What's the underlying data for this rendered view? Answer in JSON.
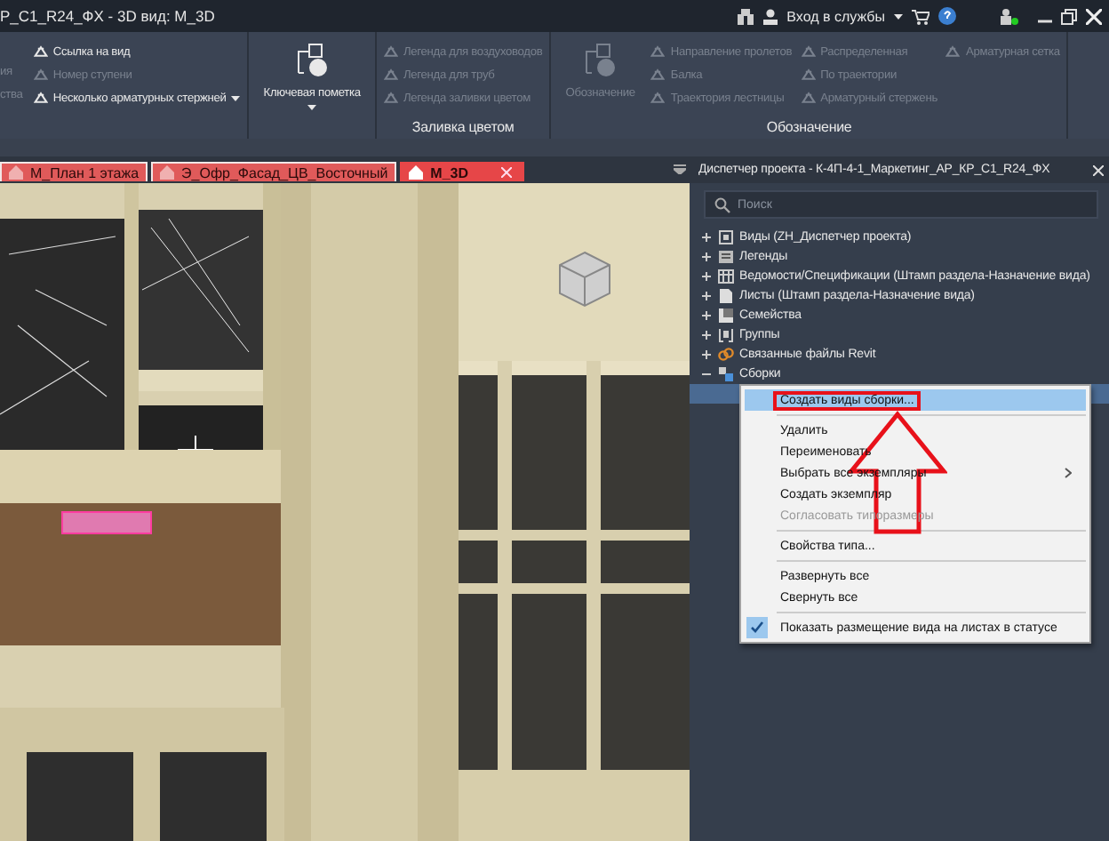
{
  "window": {
    "title": "Р_С1_R24_ФХ - 3D вид: М_3D",
    "sign_in": "Вход в службы"
  },
  "ribbon": {
    "cut_column": [
      "ия",
      "ства"
    ],
    "groups": [
      {
        "columns": [
          {
            "kind": "list",
            "items": [
              {
                "label": "Ссылка на вид",
                "disabled": false
              },
              {
                "label": "Номер ступени",
                "disabled": true
              },
              {
                "label": "Несколько арматурных стержней",
                "disabled": false,
                "dropdown": true
              }
            ]
          }
        ]
      },
      {
        "columns": [
          {
            "kind": "big",
            "label": "Ключевая пометка",
            "disabled": false,
            "dropdown": true
          }
        ]
      },
      {
        "title": "Заливка цветом",
        "columns": [
          {
            "kind": "list",
            "items": [
              {
                "label": "Легенда для воздуховодов",
                "disabled": true
              },
              {
                "label": "Легенда для труб",
                "disabled": true
              },
              {
                "label": "Легенда заливки цветом",
                "disabled": true
              }
            ]
          }
        ]
      },
      {
        "title": "Обозначение",
        "columns": [
          {
            "kind": "big",
            "label": "Обозначение",
            "disabled": true
          },
          {
            "kind": "list",
            "items": [
              {
                "label": "Направление пролетов",
                "disabled": true
              },
              {
                "label": "Балка",
                "disabled": true
              },
              {
                "label": "Траектория  лестницы",
                "disabled": true
              }
            ]
          },
          {
            "kind": "list",
            "items": [
              {
                "label": "Распределенная",
                "disabled": true
              },
              {
                "label": "По траектории",
                "disabled": true
              },
              {
                "label": "Арматурный стержень",
                "disabled": true
              }
            ]
          },
          {
            "kind": "list",
            "items": [
              {
                "label": "Арматурная сетка",
                "disabled": true
              }
            ]
          }
        ]
      }
    ]
  },
  "tabs": [
    {
      "label": "М_План 1 этажа",
      "selected": false
    },
    {
      "label": "Э_Офр_Фасад_ЦВ_Восточный",
      "selected": false
    },
    {
      "label": "М_3D",
      "selected": true
    }
  ],
  "browser": {
    "title": "Диспетчер проекта - К-4П-4-1_Маркетинг_АР_КР_С1_R24_ФХ",
    "search": {
      "placeholder": "Поиск"
    },
    "tree": [
      {
        "kind": "views",
        "label": "Виды (ZH_Диспетчер проекта)",
        "expanded": false
      },
      {
        "kind": "legends",
        "label": "Легенды",
        "expanded": false
      },
      {
        "kind": "schedules",
        "label": "Ведомости/Спецификации (Штамп раздела-Назначение вида)",
        "expanded": false
      },
      {
        "kind": "sheets",
        "label": "Листы (Штамп раздела-Назначение вида)",
        "expanded": false
      },
      {
        "kind": "families",
        "label": "Семейства",
        "expanded": false
      },
      {
        "kind": "groups",
        "label": "Группы",
        "expanded": false
      },
      {
        "kind": "links",
        "label": "Связанные файлы Revit",
        "expanded": false
      },
      {
        "kind": "assemblies",
        "label": "Сборки",
        "expanded": true,
        "children": [
          {
            "selected": true
          }
        ]
      }
    ]
  },
  "context_menu": {
    "items": [
      {
        "kind": "item",
        "label": "Создать виды сборки...",
        "selected": true,
        "disabled": false,
        "framed": true
      },
      {
        "kind": "separator"
      },
      {
        "kind": "item",
        "label": "Удалить",
        "selected": false,
        "disabled": false
      },
      {
        "kind": "item",
        "label": "Переименовать",
        "selected": false,
        "disabled": false
      },
      {
        "kind": "item",
        "label": "Выбрать все экземпляры",
        "selected": false,
        "disabled": false,
        "submenu": true
      },
      {
        "kind": "item",
        "label": "Создать экземпляр",
        "selected": false,
        "disabled": false
      },
      {
        "kind": "item",
        "label": "Согласовать типоразмеры",
        "selected": false,
        "disabled": true
      },
      {
        "kind": "separator"
      },
      {
        "kind": "item",
        "label": "Свойства типа...",
        "selected": false,
        "disabled": false
      },
      {
        "kind": "separator"
      },
      {
        "kind": "item",
        "label": "Развернуть все",
        "selected": false,
        "disabled": false
      },
      {
        "kind": "item",
        "label": "Свернуть все",
        "selected": false,
        "disabled": false
      },
      {
        "kind": "separator"
      },
      {
        "kind": "check",
        "label": "Показать размещение вида на листах в статусе",
        "selected": false,
        "disabled": false,
        "checked": true
      }
    ]
  }
}
